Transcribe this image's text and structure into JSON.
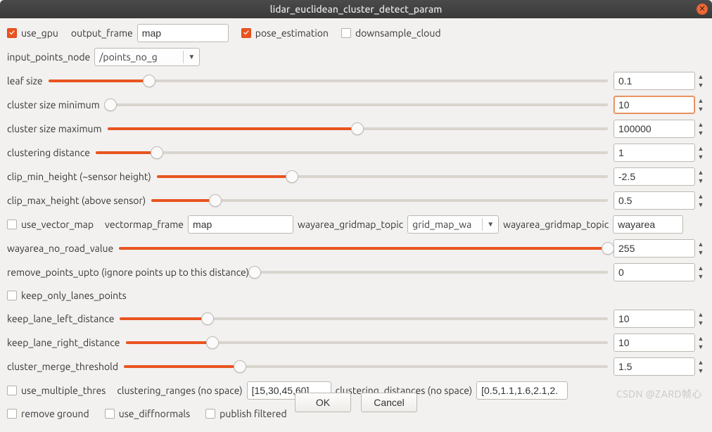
{
  "window": {
    "title": "lidar_euclidean_cluster_detect_param"
  },
  "checkboxes": {
    "use_gpu": {
      "label": "use_gpu",
      "checked": true
    },
    "pose_estimation": {
      "label": "pose_estimation",
      "checked": true
    },
    "downsample_cloud": {
      "label": "downsample_cloud",
      "checked": false
    },
    "use_vector_map": {
      "label": "use_vector_map",
      "checked": false
    },
    "keep_only_lanes_points": {
      "label": "keep_only_lanes_points",
      "checked": false
    },
    "use_multiple_thres": {
      "label": "use_multiple_thres",
      "checked": false
    },
    "remove_ground": {
      "label": "remove ground",
      "checked": false
    },
    "use_diffnormals": {
      "label": "use_diffnormals",
      "checked": false
    },
    "publish_filtered": {
      "label": "publish filtered",
      "checked": false
    }
  },
  "fields": {
    "output_frame": {
      "label": "output_frame",
      "value": "map"
    },
    "input_points_node": {
      "label": "input_points_node",
      "value": "/points_no_g"
    },
    "vectormap_frame": {
      "label": "vectormap_frame",
      "value": "map"
    },
    "wayarea_gridmap_topic": {
      "label": "wayarea_gridmap_topic",
      "value": "grid_map_wa"
    },
    "wayarea_gridmap_topic2": {
      "label": "wayarea_gridmap_topic",
      "value": "wayarea"
    },
    "clustering_ranges": {
      "label": "clustering_ranges (no space)",
      "value": "[15,30,45,60]"
    },
    "clustering_distances": {
      "label": "clustering_distances (no space)",
      "value": "[0.5,1.1,1.6,2.1,2."
    }
  },
  "sliders": {
    "leaf_size": {
      "label": "leaf size",
      "value": "0.1",
      "pct": 18
    },
    "cluster_size_minimum": {
      "label": "cluster size minimum",
      "value": "10",
      "pct": 1,
      "active": true
    },
    "cluster_size_maximum": {
      "label": "cluster size maximum",
      "value": "100000",
      "pct": 50
    },
    "clustering_distance": {
      "label": "clustering distance",
      "value": "1",
      "pct": 12
    },
    "clip_min_height": {
      "label": "clip_min_height (~sensor height)",
      "value": "-2.5",
      "pct": 30
    },
    "clip_max_height": {
      "label": "clip_max_height (above sensor)",
      "value": "0.5",
      "pct": 14
    },
    "wayarea_no_road_value": {
      "label": "wayarea_no_road_value",
      "value": "255",
      "pct": 100
    },
    "remove_points_upto": {
      "label": "remove_points_upto (ignore points up to this distance)",
      "value": "0",
      "pct": 0
    },
    "keep_lane_left_distance": {
      "label": "keep_lane_left_distance",
      "value": "10",
      "pct": 18
    },
    "keep_lane_right_distance": {
      "label": "keep_lane_right_distance",
      "value": "10",
      "pct": 18
    },
    "cluster_merge_threshold": {
      "label": "cluster_merge_threshold",
      "value": "1.5",
      "pct": 24
    }
  },
  "buttons": {
    "ok": "OK",
    "cancel": "Cancel"
  },
  "watermark": "CSDN @ZARD帧心"
}
